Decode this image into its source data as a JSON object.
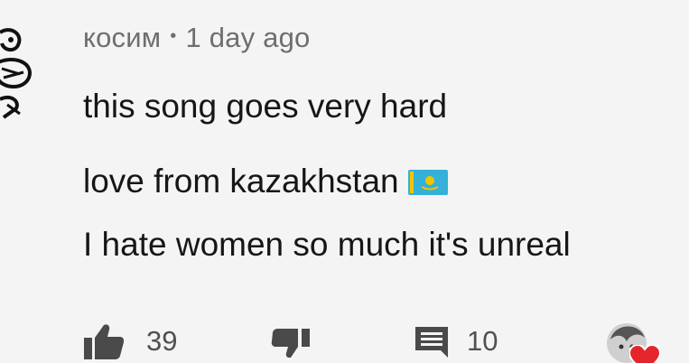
{
  "comment": {
    "author": "косим",
    "separator": "•",
    "timestamp": "1 day ago",
    "lines": [
      "this song goes very hard",
      "love from kazakhstan",
      "I hate women so much it's unreal"
    ],
    "flag_icon": "kazakhstan-flag-emoji"
  },
  "actions": {
    "like_icon": "thumbs-up-icon",
    "like_count": "39",
    "dislike_icon": "thumbs-down-icon",
    "reply_icon": "reply-comment-icon",
    "reply_count": "10",
    "creator_heart_icon": "heart-icon"
  },
  "colors": {
    "background": "#f4f4f4",
    "text": "#161616",
    "meta_text": "#6e6e6e",
    "flag_blue": "#35b0d8",
    "flag_gold": "#f2c500",
    "heart_red": "#e5252c"
  }
}
